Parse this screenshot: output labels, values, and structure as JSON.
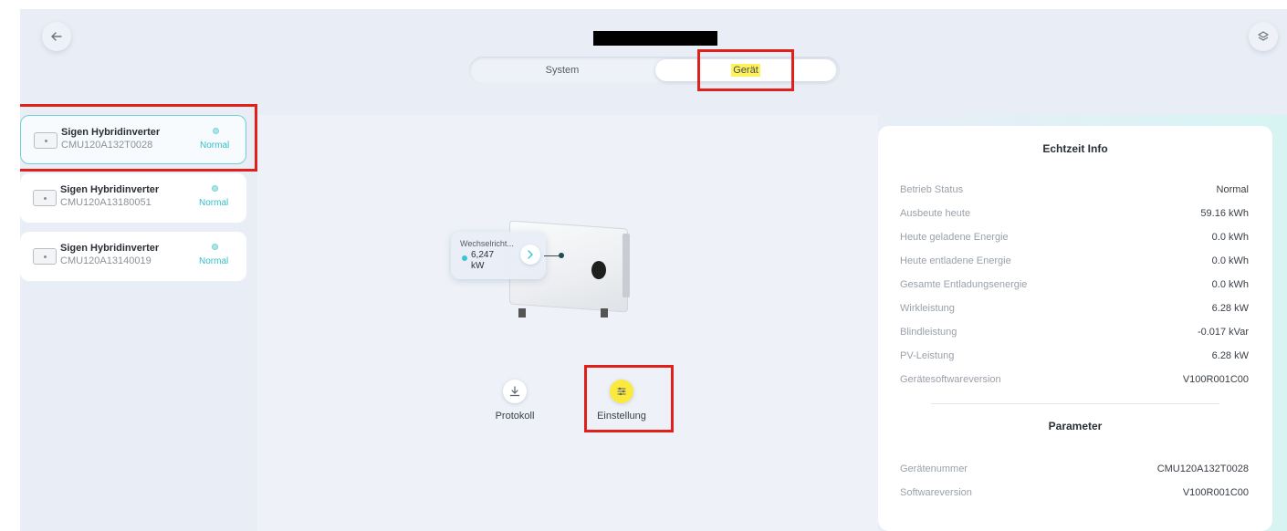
{
  "header": {
    "tabs": [
      {
        "label": "System",
        "active": false
      },
      {
        "label": "Gerät",
        "active": true
      }
    ]
  },
  "sidebar": {
    "devices": [
      {
        "name": "Sigen Hybridinverter",
        "serial": "CMU120A132T0028",
        "status": "Normal",
        "selected": true
      },
      {
        "name": "Sigen Hybridinverter",
        "serial": "CMU120A13180051",
        "status": "Normal",
        "selected": false
      },
      {
        "name": "Sigen Hybridinverter",
        "serial": "CMU120A13140019",
        "status": "Normal",
        "selected": false
      }
    ]
  },
  "device_view": {
    "tooltip": {
      "title": "Wechselricht...",
      "value": "6,247",
      "unit": "kW"
    },
    "actions": [
      {
        "label": "Protokoll",
        "icon": "download-icon"
      },
      {
        "label": "Einstellung",
        "icon": "sliders-icon"
      }
    ]
  },
  "realtime": {
    "title": "Echtzeit Info",
    "rows": [
      {
        "label": "Betrieb Status",
        "value": "Normal"
      },
      {
        "label": "Ausbeute heute",
        "value": "59.16 kWh"
      },
      {
        "label": "Heute geladene Energie",
        "value": "0.0 kWh"
      },
      {
        "label": "Heute entladene Energie",
        "value": "0.0 kWh"
      },
      {
        "label": "Gesamte Entladungsenergie",
        "value": "0.0 kWh"
      },
      {
        "label": "Wirkleistung",
        "value": "6.28 kW"
      },
      {
        "label": "Blindleistung",
        "value": "-0.017 kVar"
      },
      {
        "label": "PV-Leistung",
        "value": "6.28 kW"
      },
      {
        "label": "Gerätesoftwareversion",
        "value": "V100R001C00"
      }
    ]
  },
  "parameter": {
    "title": "Parameter",
    "rows": [
      {
        "label": "Gerätenummer",
        "value": "CMU120A132T0028"
      },
      {
        "label": "Softwareversion",
        "value": "V100R001C00"
      }
    ]
  },
  "colors": {
    "accent": "#32bfc6",
    "highlight": "#fdf25a",
    "annotation": "#e0201b"
  }
}
